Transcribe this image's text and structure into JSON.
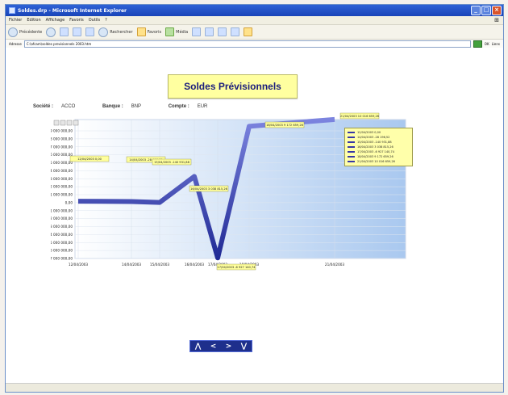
{
  "window": {
    "title": "Soldes.drp - Microsoft Internet Explorer",
    "menu": [
      "Fichier",
      "Edition",
      "Affichage",
      "Favoris",
      "Outils",
      "?"
    ],
    "toolbar": {
      "back": "Précédente",
      "search": "Rechercher",
      "favorites": "Favoris",
      "media": "Média"
    },
    "address_label": "Adresse",
    "address": "C:\\afcam\\soldes previsionnels 2003.htm",
    "go_label": "OK",
    "links_label": "Liens"
  },
  "page": {
    "title": "Soldes Prévisionnels",
    "info": {
      "societe_label": "Société :",
      "societe_value": "ACCO",
      "banque_label": "Banque :",
      "banque_value": "BNP",
      "compte_label": "Compte :",
      "compte_value": "EUR"
    },
    "navigation": [
      "⋀",
      "<",
      ">",
      "⋁"
    ]
  },
  "chart_data": {
    "type": "line",
    "x": [
      "12/04/2003",
      "14/04/2003",
      "15/04/2003",
      "16/04/2003",
      "17/04/2003",
      "18/04/2003",
      "21/04/2003"
    ],
    "y": [
      0.0,
      -28196.52,
      -140931.88,
      3038815.26,
      -6927140.74,
      9172659.26,
      10016659.26
    ],
    "labels": [
      "12/04/2003 0,00",
      "14/04/2003 -28 196,52",
      "15/04/2003 -140 931,88",
      "16/04/2003 3 038 815,26",
      "17/04/2003 -6 927 140,74",
      "18/04/2003 9 172 659,26",
      "21/04/2003 10 016 659,26"
    ],
    "ylabels": [
      "9 000 000,00",
      "8 000 000,00",
      "7 000 000,00",
      "6 000 000,00",
      "5 000 000,00",
      "4 000 000,00",
      "3 000 000,00",
      "2 000 000,00",
      "1 000 000,00",
      "0,00",
      "-1 000 000,00",
      "-2 000 000,00",
      "-3 000 000,00",
      "-4 000 000,00",
      "-5 000 000,00",
      "-6 000 000,00",
      "-7 000 000,00"
    ],
    "ylim": [
      -7000000,
      10000000
    ],
    "legend": [
      "12/04/2003 0,00",
      "14/04/2003 -28 196,52",
      "15/04/2003 -140 931,88",
      "16/04/2003 3 038 815,26",
      "17/04/2003 -6 927 140,74",
      "18/04/2003 9 172 659,26",
      "21/04/2003 10 016 659,26"
    ]
  }
}
